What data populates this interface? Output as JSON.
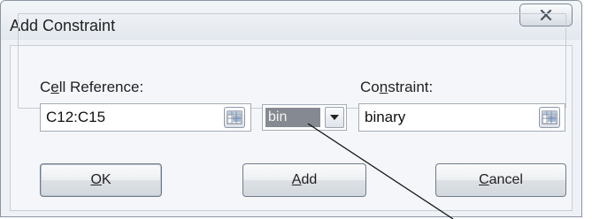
{
  "dialog": {
    "title": "Add Constraint",
    "close_glyph": "x",
    "cell_reference": {
      "label_pre": "C",
      "label_mnemonic": "e",
      "label_post": "ll Reference:",
      "value": "C12:C15"
    },
    "operator": {
      "selected": "bin"
    },
    "constraint": {
      "label_pre": "Co",
      "label_mnemonic": "n",
      "label_post": "straint:",
      "value": "binary"
    },
    "buttons": {
      "ok_mnemonic": "O",
      "ok_post": "K",
      "add_mnemonic": "A",
      "add_post": "dd",
      "cancel_mnemonic": "C",
      "cancel_post": "ancel"
    }
  },
  "icons": {
    "close": "close-icon",
    "range_select": "range-select-icon",
    "dropdown": "chevron-down-icon"
  },
  "colors": {
    "selection": "#858a92",
    "window_bg": "#eef2f7"
  }
}
